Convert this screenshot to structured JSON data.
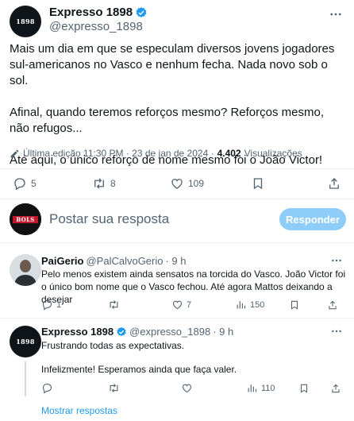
{
  "main_tweet": {
    "author_name": "Expresso 1898",
    "author_handle": "@expresso_1898",
    "avatar_label": "1898",
    "text_paragraphs": [
      "Mais um dia em que se especulam diversos jovens jogadores sul-americanos no Vasco e nenhum fecha. Nada novo sob o sol.",
      "Afinal, quando teremos reforços mesmo? Reforços mesmo, não refugos...",
      "Até aqui, o único reforço de nome mesmo foi o João Victor!"
    ],
    "edit_info": "Última edição 11:30 PM · 23 de jan de 2024 ·",
    "views_count": "4.402",
    "views_label": "Visualizações",
    "actions": {
      "replies": "5",
      "retweets": "8",
      "likes": "109"
    }
  },
  "composer": {
    "placeholder": "Postar sua resposta",
    "button_label": "Responder",
    "avatar_label": "BOLS"
  },
  "replies": [
    {
      "author_name": "PaiGerio",
      "author_handle": "@PalCalvoGerio",
      "time": "· 9 h",
      "text": "Pelo menos existem ainda sensatos na torcida do Vasco. João Victor foi o único bom nome que o Vasco fechou. Até agora Mattos deixando a desejar",
      "actions": {
        "replies": "1",
        "retweets": "",
        "likes": "7",
        "views": "150"
      }
    },
    {
      "author_name": "Expresso 1898",
      "author_handle": "@expresso_1898",
      "time": "· 9 h",
      "avatar_label": "1898",
      "text_lines": [
        "Frustrando todas as expectativas.",
        "Infelizmente! Esperamos ainda que faça valer."
      ],
      "actions": {
        "replies": "",
        "retweets": "",
        "likes": "",
        "views": "110"
      }
    }
  ],
  "show_replies_label": "Mostrar respostas",
  "colors": {
    "accent": "#1d9bf0",
    "button_disabled": "#8ecdf8",
    "muted": "#536471",
    "divider": "#eff3f4"
  },
  "icons": [
    "verified-badge-icon",
    "more-icon",
    "edit-pencil-icon",
    "reply-icon",
    "retweet-icon",
    "like-icon",
    "bookmark-icon",
    "share-icon",
    "views-icon"
  ]
}
